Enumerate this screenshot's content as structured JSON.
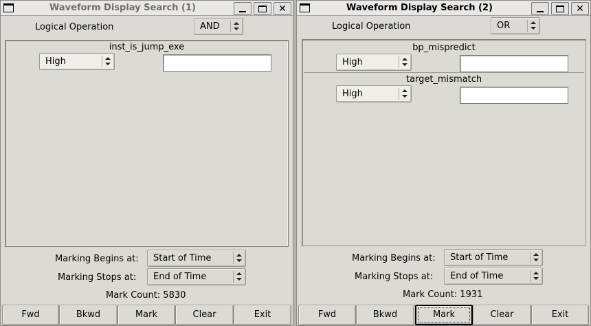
{
  "windows": [
    {
      "title": "Waveform Display Search (1)",
      "logical_operation_label": "Logical Operation",
      "logical_operation_value": "AND",
      "signals": [
        {
          "name": "inst_is_jump_exe",
          "condition": "High",
          "value": ""
        }
      ],
      "marking_begins_label": "Marking Begins at:",
      "marking_begins_value": "Start of Time",
      "marking_stops_label": "Marking Stops at:",
      "marking_stops_value": "End of Time",
      "mark_count_label": "Mark Count: 5830",
      "buttons": {
        "fwd": "Fwd",
        "bkwd": "Bkwd",
        "mark": "Mark",
        "clear": "Clear",
        "exit": "Exit"
      }
    },
    {
      "title": "Waveform Display Search (2)",
      "logical_operation_label": "Logical Operation",
      "logical_operation_value": "OR",
      "signals": [
        {
          "name": "bp_mispredict",
          "condition": "High",
          "value": ""
        },
        {
          "name": "target_mismatch",
          "condition": "High",
          "value": ""
        }
      ],
      "marking_begins_label": "Marking Begins at:",
      "marking_begins_value": "Start of Time",
      "marking_stops_label": "Marking Stops at:",
      "marking_stops_value": "End of Time",
      "mark_count_label": "Mark Count: 1931",
      "buttons": {
        "fwd": "Fwd",
        "bkwd": "Bkwd",
        "mark": "Mark",
        "clear": "Clear",
        "exit": "Exit"
      }
    }
  ],
  "icons": {
    "window_menu": "window-menu-icon",
    "minimize": "minimize-icon",
    "maximize": "maximize-icon",
    "close": "close-icon",
    "spinner": "up-down-arrows-icon"
  },
  "colors": {
    "window_bg": "#dcdad5",
    "titlebar_bg": "#e9e8e4",
    "inactive_title": "#6e6e6e",
    "entry_bg": "#ffffff"
  }
}
